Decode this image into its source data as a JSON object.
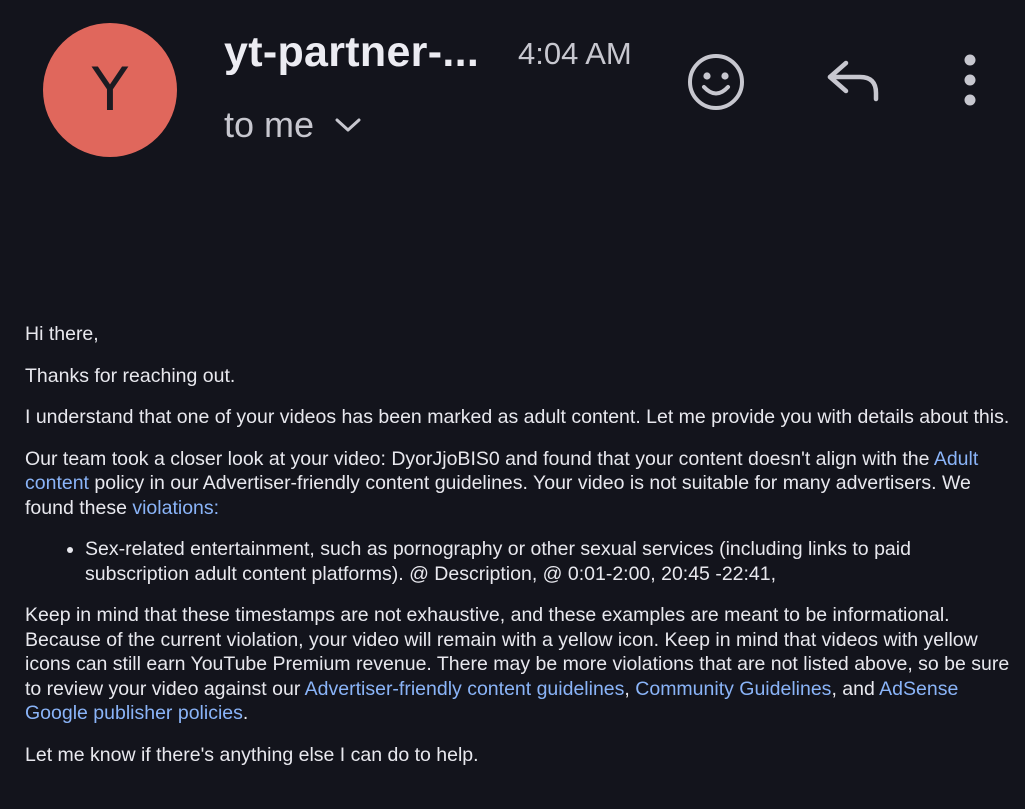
{
  "header": {
    "avatar_letter": "Y",
    "sender": "yt-partner-...",
    "time": "4:04 AM",
    "recipient": "to me",
    "icons": [
      "smiley-icon",
      "reply-icon",
      "more-vert-icon",
      "chevron-down-icon"
    ]
  },
  "email": {
    "greeting": "Hi there,",
    "thanks": "Thanks for reaching out.",
    "intro": "I understand that one of your videos has been marked as adult content. Let me provide you with details about this.",
    "review": {
      "before_link": "Our team took a closer look at your video: DyorJjoBIS0 and found that your content doesn't align with the ",
      "link_adult": "Adult content",
      "middle": " policy in our Advertiser-friendly content guidelines. Your video is not suitable for many advertisers. We found these ",
      "link_violations": "violations:"
    },
    "violations": [
      "Sex-related entertainment, such as pornography or other sexual services (including links to paid subscription adult content platforms). @ Description, @ 0:01-2:00, 20:45 -22:41,"
    ],
    "notice": {
      "text": "Keep in mind that these timestamps are not exhaustive, and these examples are meant to be informational. Because of the current violation, your video will remain with a yellow icon. Keep in mind that videos with yellow icons can still earn YouTube Premium revenue. There may be more violations that are not listed above, so be sure to review your video against our ",
      "link_afcg": "Advertiser-friendly content guidelines",
      "sep1": ", ",
      "link_community": "Community Guidelines",
      "sep2": ", and ",
      "link_adsense": "AdSense Google publisher policies",
      "end": "."
    },
    "closing": "Let me know if there's anything else I can do to help."
  },
  "colors": {
    "background": "#13141c",
    "avatar": "#e0675c",
    "link": "#8ab4f8",
    "text": "#e8e8ee"
  }
}
